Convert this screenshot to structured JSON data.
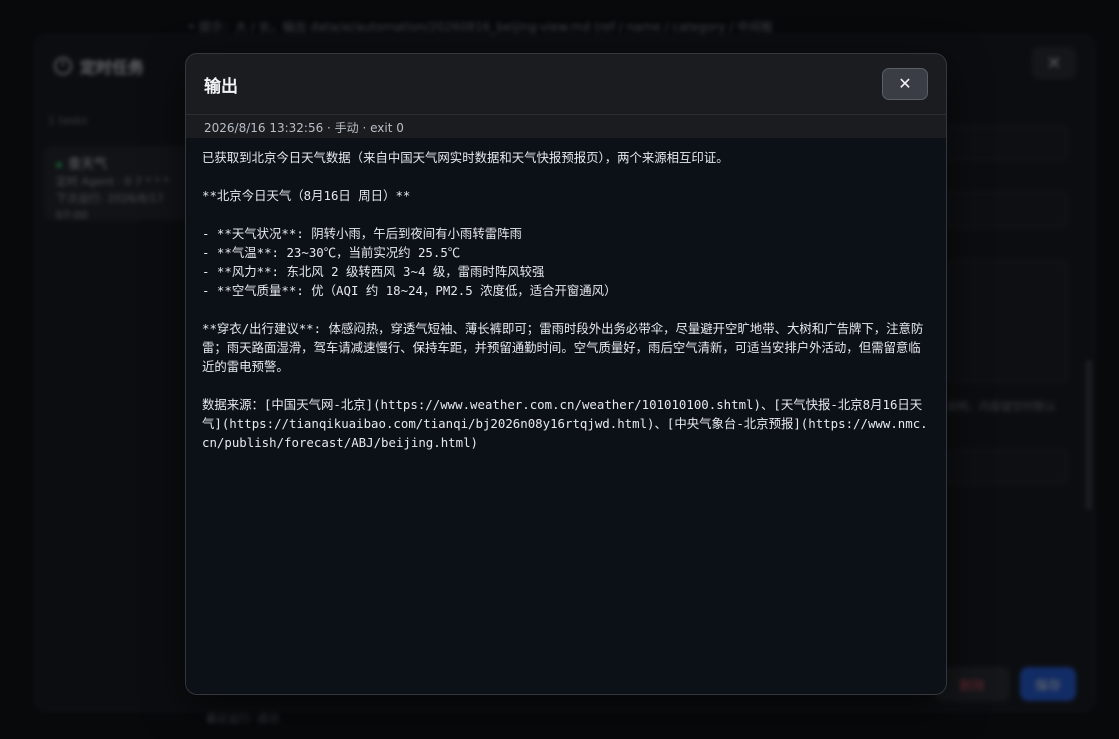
{
  "background": {
    "top_line": "• 提示：大 / 长，输出 data/ai/automation/20260816_beijing-view.md   (ref / name / category / 中间板",
    "panel_title": "定时任务",
    "close_symbol": "✕",
    "task_count": "1 tasks",
    "task": {
      "name": "查天气",
      "line1": "定时 Agent · 0 7 * * *",
      "line2": "下次运行: 2026/8/17 07:00"
    },
    "hint": "说明，内容留空时默认",
    "delete_label": "删除",
    "save_label": "保存",
    "footer_text": "最近运行: 成功"
  },
  "modal": {
    "title": "输出",
    "close_symbol": "✕",
    "meta": "2026/8/16 13:32:56 · 手动 · exit 0",
    "output": "已获取到北京今日天气数据（来自中国天气网实时数据和天气快报预报页），两个来源相互印证。\n\n**北京今日天气（8月16日 周日）**\n\n- **天气状况**: 阴转小雨，午后到夜间有小雨转雷阵雨\n- **气温**: 23~30℃，当前实况约 25.5℃\n- **风力**: 东北风 2 级转西风 3~4 级，雷雨时阵风较强\n- **空气质量**: 优（AQI 约 18~24，PM2.5 浓度低，适合开窗通风）\n\n**穿衣/出行建议**: 体感闷热，穿透气短袖、薄长裤即可；雷雨时段外出务必带伞，尽量避开空旷地带、大树和广告牌下，注意防雷；雨天路面湿滑，驾车请减速慢行、保持车距，并预留通勤时间。空气质量好，雨后空气清新，可适当安排户外活动，但需留意临近的雷电预警。\n\n数据来源：[中国天气网-北京](https://www.weather.com.cn/weather/101010100.shtml)、[天气快报-北京8月16日天气](https://tianqikuaibao.com/tianqi/bj2026n08y16rtqjwd.html)、[中央气象台-北京预报](https://www.nmc.cn/publish/forecast/ABJ/beijing.html)"
  }
}
